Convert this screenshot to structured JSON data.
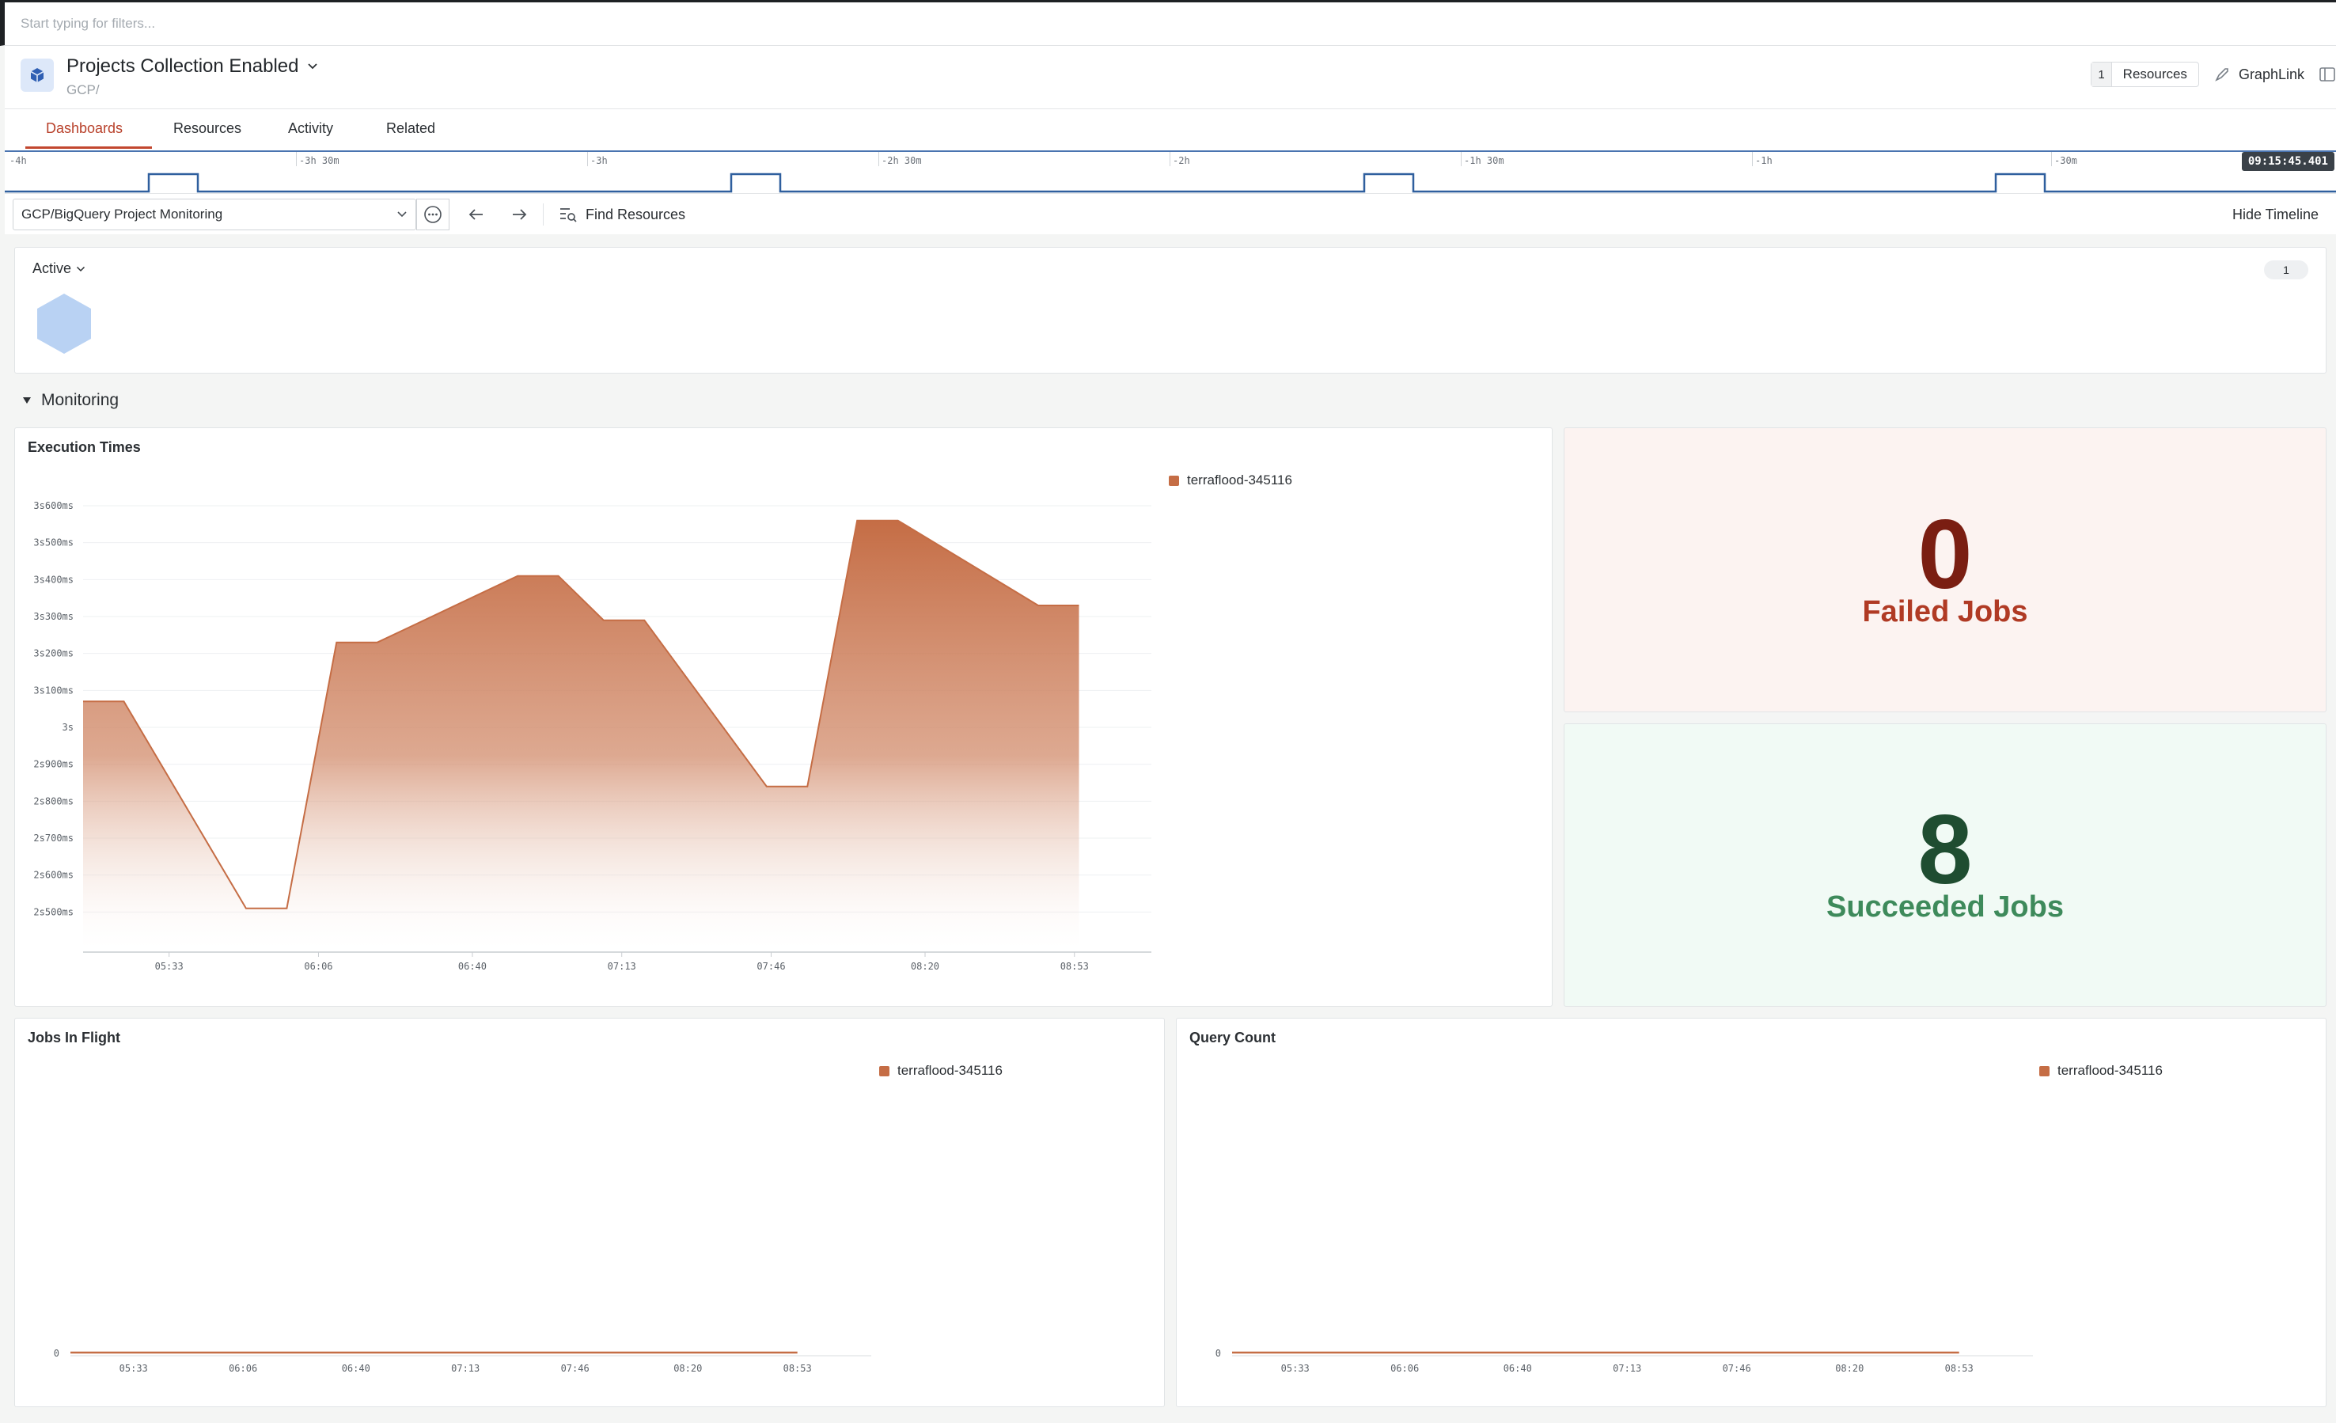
{
  "filter": {
    "placeholder": "Start typing for filters..."
  },
  "header": {
    "title": "Projects Collection Enabled",
    "subtitle": "GCP/",
    "resources_count": "1",
    "resources_label": "Resources",
    "graphlink_label": "GraphLink"
  },
  "tabs": [
    {
      "label": "Dashboards",
      "active": true
    },
    {
      "label": "Resources",
      "active": false
    },
    {
      "label": "Activity",
      "active": false
    },
    {
      "label": "Related",
      "active": false
    }
  ],
  "timeline": {
    "labels": [
      "-4h",
      "-3h 30m",
      "-3h",
      "-2h 30m",
      "-2h",
      "-1h 30m",
      "-1h",
      "-30m"
    ],
    "now": "09:15:45.401"
  },
  "toolbar": {
    "dashboard_select": "GCP/BigQuery Project Monitoring",
    "find_resources": "Find Resources",
    "hide_timeline": "Hide Timeline"
  },
  "active_card": {
    "label": "Active",
    "count": "1",
    "color": "#b9d2f3"
  },
  "section": {
    "title": "Monitoring"
  },
  "execution_chart": {
    "title": "Execution Times",
    "legend": "terraflood-345116",
    "color": "#c56d45"
  },
  "failed": {
    "value": "0",
    "label": "Failed Jobs",
    "value_color": "#7a1e12",
    "label_color": "#b03a24"
  },
  "succeeded": {
    "value": "8",
    "label": "Succeeded Jobs",
    "value_color": "#1f4d31",
    "label_color": "#3e8a5b"
  },
  "jobs_chart": {
    "title": "Jobs In Flight",
    "legend": "terraflood-345116"
  },
  "query_chart": {
    "title": "Query Count",
    "legend": "terraflood-345116"
  },
  "chart_data": [
    {
      "type": "area",
      "title": "Execution Times",
      "series": [
        {
          "name": "terraflood-345116",
          "x": [
            "05:14",
            "05:23",
            "05:50",
            "05:59",
            "06:10",
            "06:19",
            "06:50",
            "06:59",
            "07:09",
            "07:18",
            "07:45",
            "07:54",
            "08:05",
            "08:14",
            "08:45",
            "08:54"
          ],
          "values": [
            3.07,
            3.07,
            2.51,
            2.51,
            3.23,
            3.23,
            3.41,
            3.41,
            3.29,
            3.29,
            2.84,
            2.84,
            3.56,
            3.56,
            3.33,
            3.33
          ]
        }
      ],
      "yunit": "s",
      "ylim": [
        2.4,
        3.66
      ],
      "yticks": [
        "2s500ms",
        "2s600ms",
        "2s700ms",
        "2s800ms",
        "2s900ms",
        "3s",
        "3s100ms",
        "3s200ms",
        "3s300ms",
        "3s400ms",
        "3s500ms",
        "3s600ms"
      ],
      "ytick_values": [
        2.5,
        2.6,
        2.7,
        2.8,
        2.9,
        3.0,
        3.1,
        3.2,
        3.3,
        3.4,
        3.5,
        3.6
      ],
      "xticks": [
        "05:33",
        "06:06",
        "06:40",
        "07:13",
        "07:46",
        "08:20",
        "08:53"
      ],
      "xlim": [
        "05:14",
        "09:10"
      ],
      "grid": true,
      "legend": "top-right"
    },
    {
      "type": "line",
      "title": "Jobs In Flight",
      "series": [
        {
          "name": "terraflood-345116",
          "x": [
            "05:14",
            "08:53"
          ],
          "values": [
            0,
            0
          ]
        }
      ],
      "yticks": [
        "0"
      ],
      "xticks": [
        "05:33",
        "06:06",
        "06:40",
        "07:13",
        "07:46",
        "08:20",
        "08:53"
      ],
      "legend": "top-right"
    },
    {
      "type": "line",
      "title": "Query Count",
      "series": [
        {
          "name": "terraflood-345116",
          "x": [
            "05:14",
            "08:53"
          ],
          "values": [
            0,
            0
          ]
        }
      ],
      "yticks": [
        "0"
      ],
      "xticks": [
        "05:33",
        "06:06",
        "06:40",
        "07:13",
        "07:46",
        "08:20",
        "08:53"
      ],
      "legend": "top-right"
    }
  ]
}
